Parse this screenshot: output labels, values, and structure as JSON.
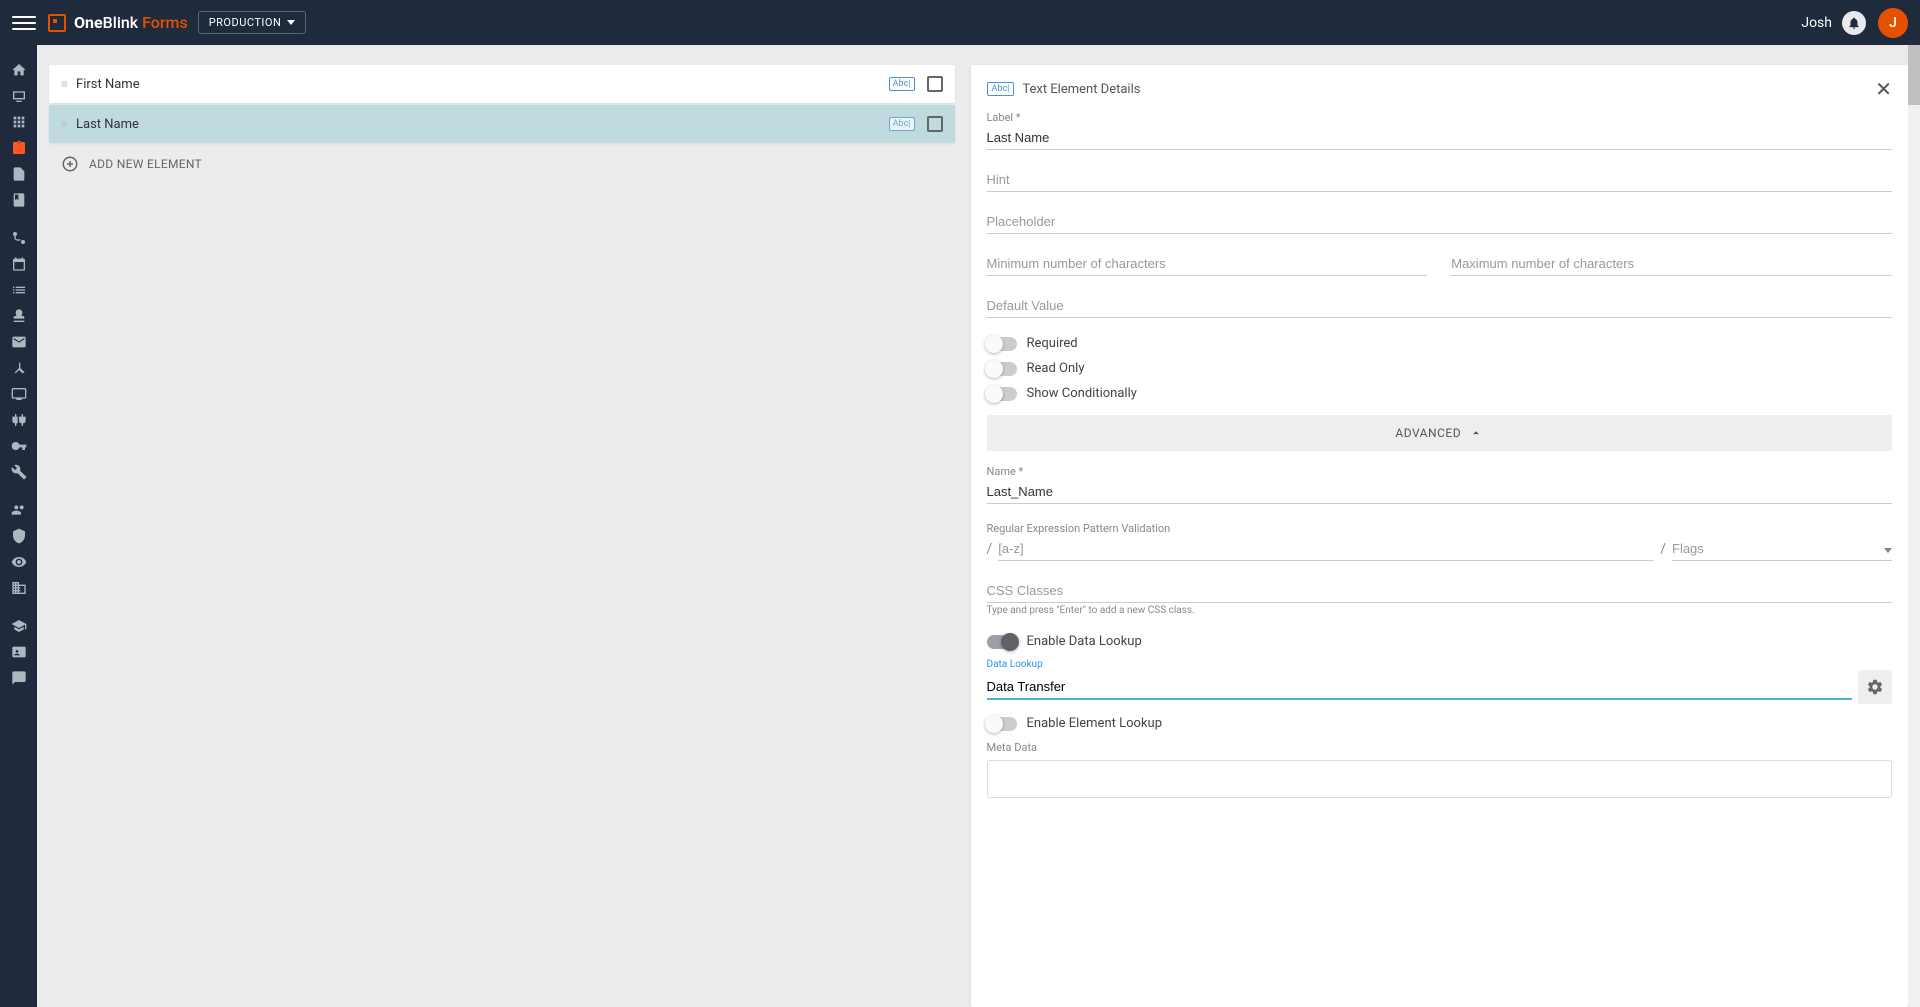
{
  "header": {
    "logo_one": "One",
    "logo_blink": "Blink",
    "logo_forms": "Forms",
    "environment": "PRODUCTION",
    "user_name": "Josh",
    "avatar_initial": "J"
  },
  "elements": [
    {
      "label": "First Name",
      "selected": false
    },
    {
      "label": "Last Name",
      "selected": true
    }
  ],
  "add_element_label": "ADD NEW ELEMENT",
  "details": {
    "panel_title": "Text Element Details",
    "badge": "Abc|",
    "label_field": {
      "label": "Label *",
      "value": "Last Name"
    },
    "hint_field": {
      "label": "Hint",
      "value": ""
    },
    "placeholder_field": {
      "label": "Placeholder",
      "value": ""
    },
    "min_chars": {
      "label": "Minimum number of characters",
      "value": ""
    },
    "max_chars": {
      "label": "Maximum number of characters",
      "value": ""
    },
    "default_value": {
      "label": "Default Value",
      "value": ""
    },
    "toggles": {
      "required": "Required",
      "read_only": "Read Only",
      "show_conditionally": "Show Conditionally",
      "enable_data_lookup": "Enable Data Lookup",
      "enable_element_lookup": "Enable Element Lookup"
    },
    "advanced_label": "ADVANCED",
    "name_field": {
      "label": "Name *",
      "value": "Last_Name"
    },
    "regex": {
      "label": "Regular Expression Pattern Validation",
      "placeholder": "[a-z]",
      "flags_label": "Flags"
    },
    "css_classes": {
      "label": "CSS Classes",
      "hint": "Type and press \"Enter\" to add a new CSS class."
    },
    "data_lookup": {
      "label": "Data Lookup",
      "value": "Data Transfer"
    },
    "meta_data_label": "Meta Data"
  }
}
